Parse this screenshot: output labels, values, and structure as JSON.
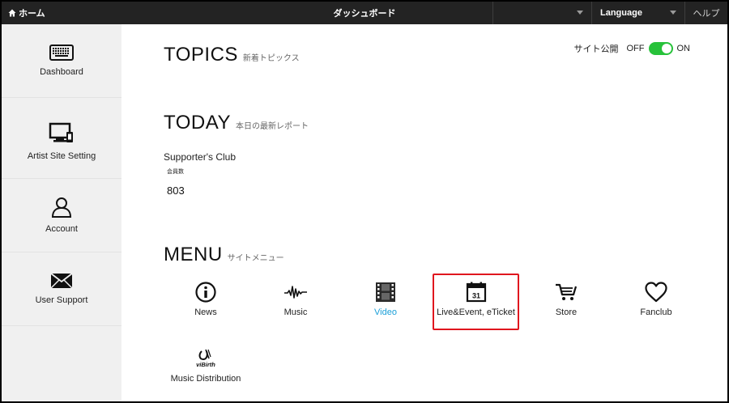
{
  "topbar": {
    "home_label": "ホーム",
    "title": "ダッシュボード",
    "language_label": "Language",
    "help_label": "ヘルプ"
  },
  "sidebar": {
    "items": [
      {
        "label": "Dashboard",
        "icon": "keyboard-icon"
      },
      {
        "label": "Artist Site Setting",
        "icon": "monitor-icon"
      },
      {
        "label": "Account",
        "icon": "user-icon"
      },
      {
        "label": "User Support",
        "icon": "envelope-icon"
      }
    ]
  },
  "publish": {
    "label": "サイト公開",
    "off": "OFF",
    "on": "ON",
    "state": "on",
    "color": "#27c23a"
  },
  "topics": {
    "title": "TOPICS",
    "subtitle": "新着トピックス"
  },
  "today": {
    "title": "TODAY",
    "subtitle": "本日の最新レポート",
    "club_name": "Supporter's Club",
    "member_label": "会員数",
    "member_count": "803"
  },
  "menu": {
    "title": "MENU",
    "subtitle": "サイトメニュー",
    "items": [
      {
        "label": "News",
        "icon": "info-icon"
      },
      {
        "label": "Music",
        "icon": "waveform-icon"
      },
      {
        "label": "Video",
        "icon": "film-icon",
        "active": true
      },
      {
        "label": "Live&Event, eTicket",
        "icon": "calendar-icon",
        "highlighted": true
      },
      {
        "label": "Store",
        "icon": "cart-icon"
      },
      {
        "label": "Fanclub",
        "icon": "heart-icon"
      },
      {
        "label": "Music Distribution",
        "icon": "virbirth-logo-icon"
      }
    ],
    "calendar_day": "31",
    "logo_text": "viBirth"
  },
  "colors": {
    "accent": "#1a9fd8",
    "highlight": "#e0161e",
    "topbar": "#232323",
    "sidebar": "#f0f0f0"
  }
}
